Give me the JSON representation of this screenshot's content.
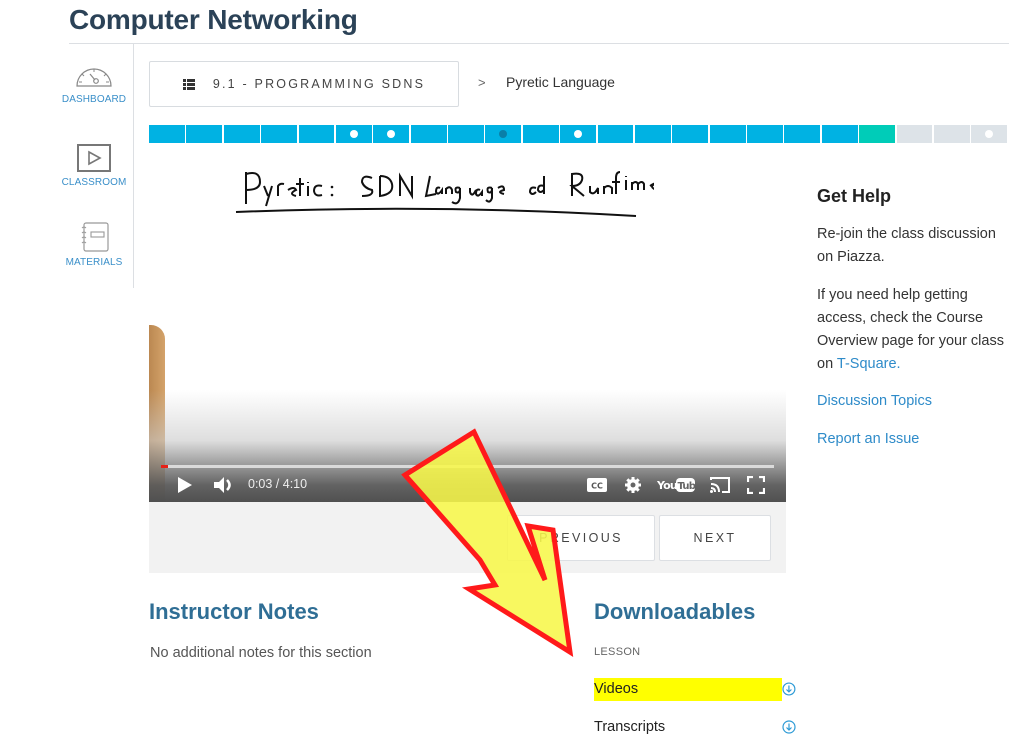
{
  "course": {
    "title": "Computer Networking"
  },
  "sidebar": {
    "items": [
      {
        "label": "DASHBOARD",
        "icon": "speedometer-icon"
      },
      {
        "label": "CLASSROOM",
        "icon": "play-box-icon"
      },
      {
        "label": "MATERIALS",
        "icon": "notebook-icon"
      }
    ]
  },
  "breadcrumb": {
    "lesson_label": "9.1 - PROGRAMMING SDNS",
    "lesson_icon": "list-icon",
    "separator": ">",
    "current": "Pyretic Language"
  },
  "progress": {
    "colors": {
      "complete": "#00b2e3",
      "current": "#00ccb8",
      "upcoming": "#dde3e8",
      "dot_white": "#ffffff",
      "dot_dark": "#0a7fa8"
    },
    "segments": [
      {
        "state": "complete",
        "dot": null
      },
      {
        "state": "complete",
        "dot": null
      },
      {
        "state": "complete",
        "dot": null
      },
      {
        "state": "complete",
        "dot": null
      },
      {
        "state": "complete",
        "dot": null
      },
      {
        "state": "complete",
        "dot": "white"
      },
      {
        "state": "complete",
        "dot": "white"
      },
      {
        "state": "complete",
        "dot": null
      },
      {
        "state": "complete",
        "dot": null
      },
      {
        "state": "complete",
        "dot": "dark"
      },
      {
        "state": "complete",
        "dot": null
      },
      {
        "state": "complete",
        "dot": "white"
      },
      {
        "state": "complete",
        "dot": null
      },
      {
        "state": "complete",
        "dot": null
      },
      {
        "state": "complete",
        "dot": null
      },
      {
        "state": "complete",
        "dot": null
      },
      {
        "state": "complete",
        "dot": null
      },
      {
        "state": "complete",
        "dot": null
      },
      {
        "state": "complete",
        "dot": null
      },
      {
        "state": "current",
        "dot": null
      },
      {
        "state": "upcoming",
        "dot": null
      },
      {
        "state": "upcoming",
        "dot": null
      },
      {
        "state": "upcoming",
        "dot": "white"
      }
    ]
  },
  "video": {
    "slide_text": "Pyretic: SDN Language and Runtime",
    "current_time": "0:03",
    "duration": "4:10",
    "time_display": "0:03 / 4:10",
    "played_fraction": 0.012,
    "controls": [
      "play-icon",
      "volume-icon",
      "closed-captions-icon",
      "settings-gear-icon",
      "youtube-logo-icon",
      "cast-icon",
      "fullscreen-icon"
    ]
  },
  "lesson_nav": {
    "previous_label": "PREVIOUS",
    "next_label": "NEXT"
  },
  "help": {
    "title": "Get Help",
    "p1": "Re-join the class discussion on Piazza.",
    "p2_prefix": "If you need help getting access, check the Course Overview page for your class on ",
    "p2_link": "T-Square.",
    "link_discussion": "Discussion Topics",
    "link_report": "Report an Issue"
  },
  "instructor_notes": {
    "title": "Instructor Notes",
    "text": "No additional notes for this section"
  },
  "downloadables": {
    "title": "Downloadables",
    "group_label": "LESSON",
    "items": [
      {
        "label": "Videos",
        "highlighted": true,
        "icon": "download-icon"
      },
      {
        "label": "Transcripts",
        "highlighted": false,
        "icon": "download-icon"
      }
    ]
  },
  "annotation": {
    "type": "arrow",
    "fill": "#f7f74a",
    "stroke": "#ff1a1a"
  }
}
